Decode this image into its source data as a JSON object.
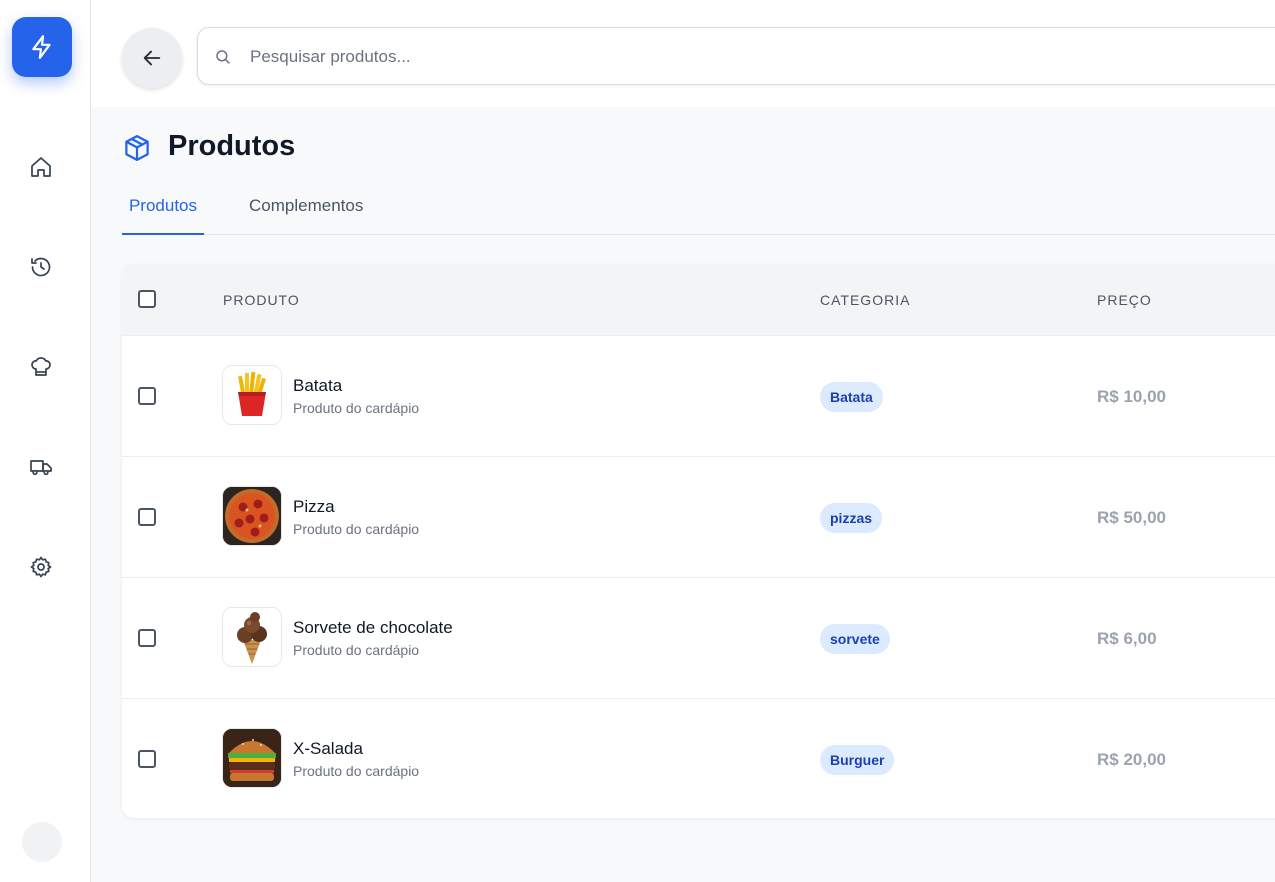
{
  "sidebar": {
    "logo_icon": "lightning-bolt-icon",
    "items": [
      {
        "name": "home",
        "icon": "home-icon"
      },
      {
        "name": "history",
        "icon": "history-icon"
      },
      {
        "name": "kitchen",
        "icon": "chef-hat-icon"
      },
      {
        "name": "delivery",
        "icon": "truck-icon"
      },
      {
        "name": "settings",
        "icon": "gear-icon"
      }
    ]
  },
  "search": {
    "placeholder": "Pesquisar produtos..."
  },
  "header": {
    "title": "Produtos"
  },
  "tabs": [
    {
      "label": "Produtos",
      "active": true
    },
    {
      "label": "Complementos",
      "active": false
    }
  ],
  "table": {
    "columns": [
      "PRODUTO",
      "CATEGORIA",
      "PREÇO"
    ],
    "rows": [
      {
        "name": "Batata",
        "description": "Produto do cardápio",
        "category": "Batata",
        "price": "R$ 10,00",
        "image": "fries"
      },
      {
        "name": "Pizza",
        "description": "Produto do cardápio",
        "category": "pizzas",
        "price": "R$ 50,00",
        "image": "pizza"
      },
      {
        "name": "Sorvete de chocolate",
        "description": "Produto do cardápio",
        "category": "sorvete",
        "price": "R$ 6,00",
        "image": "ice-cream"
      },
      {
        "name": "X-Salada",
        "description": "Produto do cardápio",
        "category": "Burguer",
        "price": "R$ 20,00",
        "image": "burger"
      }
    ]
  },
  "colors": {
    "accent": "#2563eb",
    "badge_bg": "#dbeafe",
    "badge_text": "#1e40af",
    "price_text": "#9ca3af"
  }
}
